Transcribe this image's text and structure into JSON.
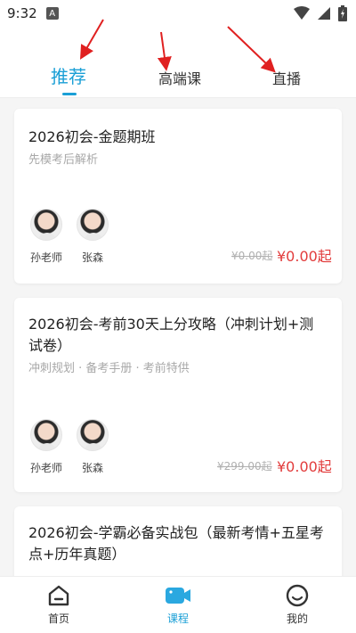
{
  "status_bar": {
    "time": "9:32",
    "notif_icon": "A"
  },
  "tabs": [
    {
      "label": "推荐",
      "active": true
    },
    {
      "label": "高端课",
      "active": false
    },
    {
      "label": "直播",
      "active": false
    }
  ],
  "courses": [
    {
      "title": "2026初会-金题期班",
      "subtitle": "先模考后解析",
      "teachers": [
        "孙老师",
        "张森"
      ],
      "price_old": "¥0.00起",
      "price_new": "¥0.00起"
    },
    {
      "title": "2026初会-考前30天上分攻略（冲刺计划+测试卷）",
      "subtitle": "冲刺规划 · 备考手册 · 考前特供",
      "teachers": [
        "孙老师",
        "张森"
      ],
      "price_old": "¥299.00起",
      "price_new": "¥0.00起"
    },
    {
      "title": "2026初会-学霸必备实战包（最新考情+五星考点+历年真题）",
      "subtitle": "",
      "teachers": [],
      "price_old": "",
      "price_new": ""
    }
  ],
  "bottom_nav": [
    {
      "label": "首页",
      "icon": "home-icon",
      "active": false
    },
    {
      "label": "课程",
      "icon": "video-camera-icon",
      "active": true
    },
    {
      "label": "我的",
      "icon": "smiley-icon",
      "active": false
    }
  ],
  "colors": {
    "accent": "#1a9fd6",
    "price": "#e23c3c",
    "annotation_arrow": "#e02020"
  }
}
